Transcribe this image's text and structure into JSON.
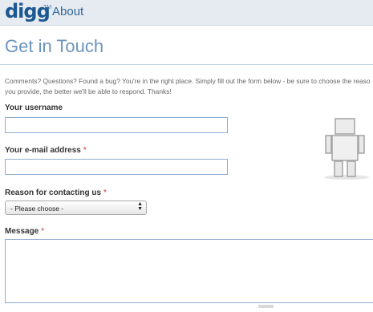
{
  "header": {
    "logo_text": "digg",
    "trademark": "TM",
    "section": "About"
  },
  "page": {
    "title": "Get in Touch",
    "intro_line1": "Comments? Questions? Found a bug? You're in the right place. Simply fill out the form below - be sure to choose the reaso",
    "intro_line2": "you provide, the better we'll be able to respond. Thanks!"
  },
  "form": {
    "username_label": "Your username",
    "email_label": "Your e-mail address",
    "reason_label": "Reason for contacting us",
    "reason_selected": "- Please choose -",
    "message_label": "Message",
    "required_marker": "*"
  },
  "icons": {
    "select_arrows": "updown-arrows-icon",
    "mascot": "digg-mascot-icon"
  },
  "colors": {
    "accent": "#6c95bd",
    "required": "#cc3333",
    "brand": "#1b5790"
  }
}
